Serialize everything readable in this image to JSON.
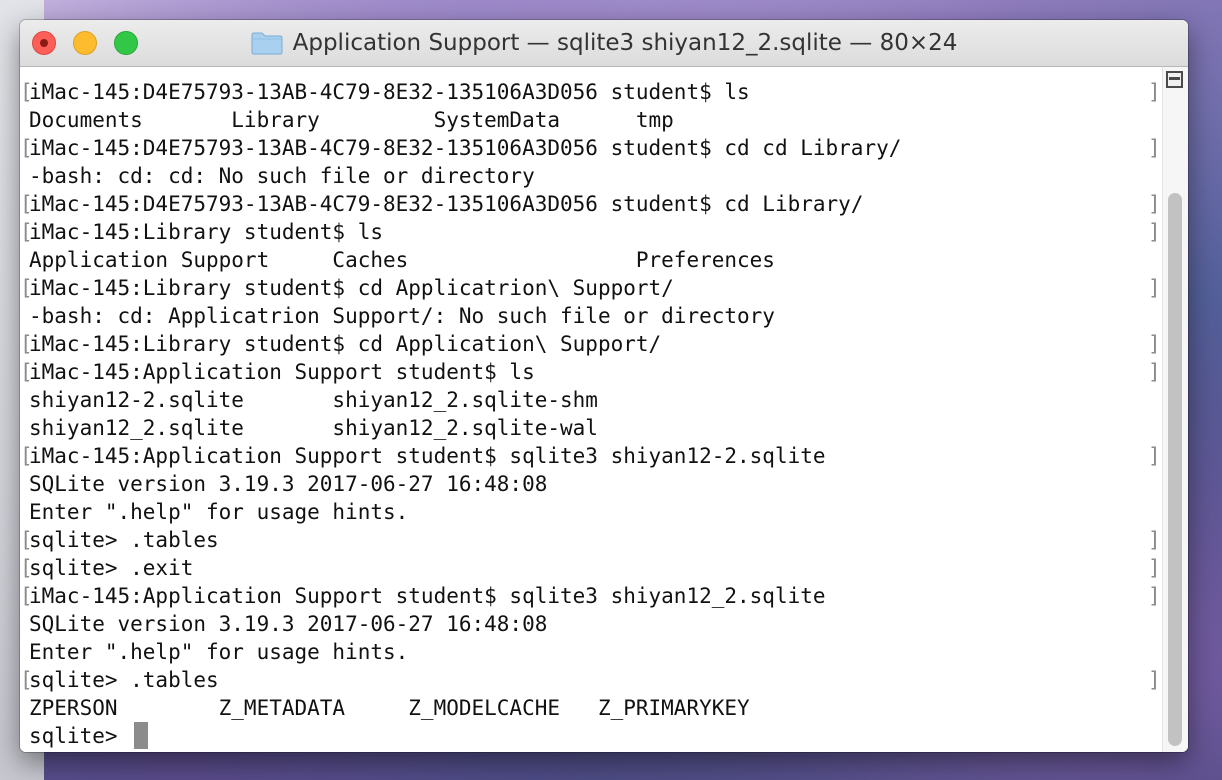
{
  "window": {
    "title": "Application Support — sqlite3 shiyan12_2.sqlite — 80×24"
  },
  "terminal": {
    "lines": [
      "iMac-145:D4E75793-13AB-4C79-8E32-135106A3D056 student$ ls",
      "Documents       Library         SystemData      tmp",
      "iMac-145:D4E75793-13AB-4C79-8E32-135106A3D056 student$ cd cd Library/",
      "-bash: cd: cd: No such file or directory",
      "iMac-145:D4E75793-13AB-4C79-8E32-135106A3D056 student$ cd Library/",
      "iMac-145:Library student$ ls",
      "Application Support     Caches                  Preferences",
      "iMac-145:Library student$ cd Applicatrion\\ Support/",
      "-bash: cd: Applicatrion Support/: No such file or directory",
      "iMac-145:Library student$ cd Application\\ Support/",
      "iMac-145:Application Support student$ ls",
      "shiyan12-2.sqlite       shiyan12_2.sqlite-shm",
      "shiyan12_2.sqlite       shiyan12_2.sqlite-wal",
      "iMac-145:Application Support student$ sqlite3 shiyan12-2.sqlite",
      "SQLite version 3.19.3 2017-06-27 16:48:08",
      "Enter \".help\" for usage hints.",
      "sqlite> .tables",
      "sqlite> .exit",
      "iMac-145:Application Support student$ sqlite3 shiyan12_2.sqlite",
      "SQLite version 3.19.3 2017-06-27 16:48:08",
      "Enter \".help\" for usage hints.",
      "sqlite> .tables",
      "ZPERSON        Z_METADATA     Z_MODELCACHE   Z_PRIMARYKEY",
      "sqlite> "
    ],
    "bracket_open": "[",
    "bracket_close": "]"
  }
}
